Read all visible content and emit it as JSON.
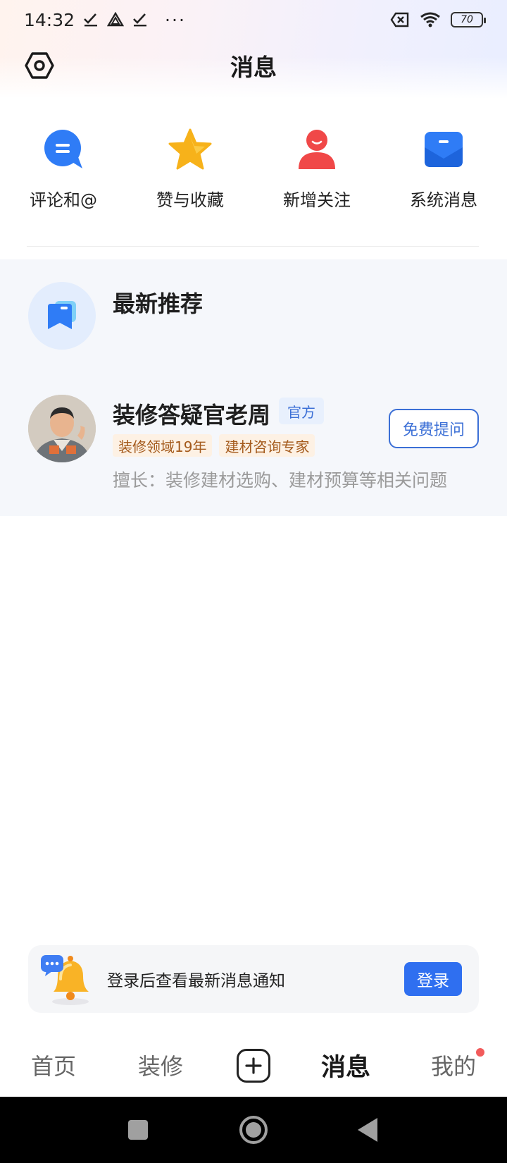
{
  "status_bar": {
    "time": "14:32",
    "more": "···",
    "battery": "70",
    "icons": [
      "check-icon",
      "drive-icon",
      "check-icon",
      "sim-off-icon",
      "wifi-icon",
      "battery-icon"
    ]
  },
  "header": {
    "title": "消息",
    "settings_icon": "settings-hexagon-icon"
  },
  "quick_actions": [
    {
      "label": "评论和@",
      "icon": "comment-bubble-icon",
      "color": "#2f7cf6"
    },
    {
      "label": "赞与收藏",
      "icon": "star-icon",
      "color": "#f7b21a"
    },
    {
      "label": "新增关注",
      "icon": "person-icon",
      "color": "#f04848"
    },
    {
      "label": "系统消息",
      "icon": "envelope-icon",
      "color": "#2f7cf6"
    }
  ],
  "recommend": {
    "title": "最新推荐",
    "icon": "recommend-flag-icon",
    "expert": {
      "name": "装修答疑官老周",
      "badge": "官方",
      "tags": [
        "装修领域19年",
        "建材咨询专家"
      ],
      "description": "擅长：装修建材选购、建材预算等相关问题",
      "action_label": "免费提问"
    }
  },
  "login_banner": {
    "text": "登录后查看最新消息通知",
    "button_label": "登录",
    "icon": "bell-icon"
  },
  "tabbar": {
    "items": [
      {
        "label": "首页",
        "active": false
      },
      {
        "label": "装修",
        "active": false
      },
      {
        "label": "消息",
        "active": true
      },
      {
        "label": "我的",
        "active": false,
        "has_dot": true
      }
    ],
    "add_icon": "plus-square-icon"
  },
  "colors": {
    "accent": "#2f6ff0",
    "badge_text": "#3b6fd6",
    "tag_text": "#a45a1c",
    "panel_bg": "#f5f7fb"
  }
}
